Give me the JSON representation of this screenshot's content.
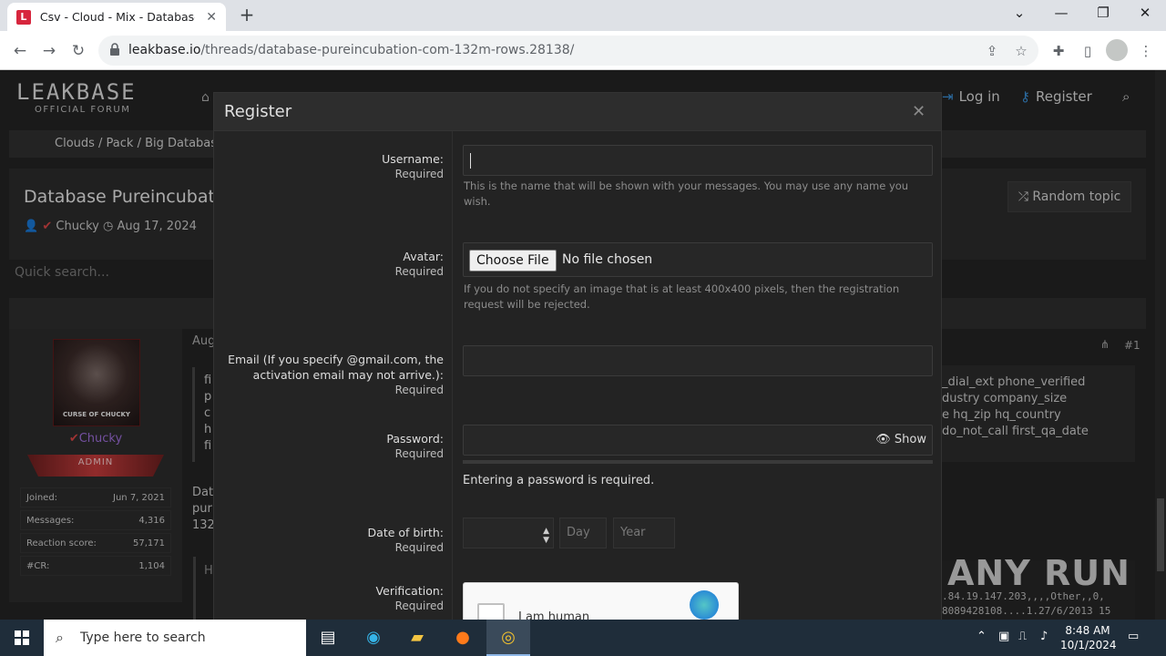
{
  "browser": {
    "tab_title": "Csv - Cloud - Mix - Database Pu",
    "url_host": "leakbase.io",
    "url_path": "/threads/database-pureincubation-com-132m-rows.28138/"
  },
  "site": {
    "logo_main": "LEAKBASE",
    "logo_sub": "OFFICIAL FORUM",
    "nav_login": "Log in",
    "nav_register": "Register",
    "breadcrumb": "Clouds / Pack / Big Databases",
    "thread_title": "Database Pureincubat",
    "author": "Chucky",
    "date": "Aug 17, 2024",
    "random_topic": "Random topic",
    "quick_search": "Quick search...",
    "post_number": "#1",
    "post_date_fragment": "Aug"
  },
  "user_card": {
    "name": "Chucky",
    "avatar_caption": "CURSE OF CHUCKY",
    "role": "ADMIN",
    "stats": [
      {
        "label": "Joined:",
        "value": "Jun 7, 2021"
      },
      {
        "label": "Messages:",
        "value": "4,316"
      },
      {
        "label": "Reaction score:",
        "value": "57,171"
      },
      {
        "label": "#CR:",
        "value": "1,104"
      }
    ]
  },
  "post_fragments": {
    "left_letters": [
      "fi",
      "p",
      "c",
      "h",
      "fi"
    ],
    "body_lines": [
      "Dat",
      "pur",
      "132"
    ],
    "right_lines": [
      "_dial_ext phone_verified",
      "dustry company_size",
      "e hq_zip hq_country",
      "do_not_call first_qa_date"
    ],
    "code_lines": [
      ".84.19.147.203,,,,Other,,0,",
      "8089428108....1.27/6/2013 15"
    ],
    "quote_letter": "H"
  },
  "watermark": "ANY RUN",
  "modal": {
    "title": "Register",
    "username_label": "Username:",
    "required": "Required",
    "username_hint": "This is the name that will be shown with your messages. You may use any name you wish.",
    "avatar_label": "Avatar:",
    "file_button": "Choose File",
    "file_status": "No file chosen",
    "avatar_hint": "If you do not specify an image that is at least 400x400 pixels, then the registration request will be rejected.",
    "email_label_line1": "Email (If you specify @gmail.com, the",
    "email_label_line2": "activation email may not arrive.):",
    "password_label": "Password:",
    "show_label": "Show",
    "password_msg": "Entering a password is required.",
    "dob_label": "Date of birth:",
    "day_placeholder": "Day",
    "year_placeholder": "Year",
    "verification_label": "Verification:",
    "captcha_text": "I am human"
  },
  "taskbar": {
    "search_placeholder": "Type here to search",
    "time": "8:48 AM",
    "date": "10/1/2024"
  },
  "colors": {
    "accent_blue": "#3a8fd6",
    "admin_red": "#c23a3a",
    "username_purple": "#9b6bd6"
  }
}
